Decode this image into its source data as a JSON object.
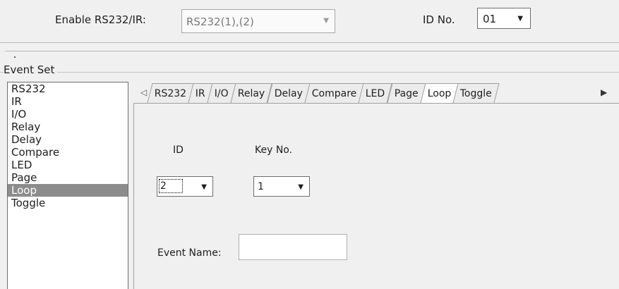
{
  "top": {
    "enable_label": "Enable RS232/IR:",
    "rs_combo_value": "RS232(1),(2)",
    "id_label": "ID No.",
    "id_value": "01"
  },
  "event_set": {
    "title": "Event Set",
    "list": [
      "RS232",
      "IR",
      "I/O",
      "Relay",
      "Delay",
      "Compare",
      "LED",
      "Page",
      "Loop",
      "Toggle"
    ],
    "selected": "Loop"
  },
  "tabs": [
    "RS232",
    "IR",
    "I/O",
    "Relay",
    "Delay",
    "Compare",
    "LED",
    "Page",
    "Loop",
    "Toggle"
  ],
  "active_tab": "Loop",
  "loop_pane": {
    "id_label": "ID",
    "id_value": "2",
    "key_label": "Key No.",
    "key_value": "1",
    "event_name_label": "Event Name:",
    "event_name_value": ""
  },
  "icons": {
    "dropdown": "chevron-down-icon",
    "tab_prev": "scroll-left-icon",
    "tab_next": "scroll-right-icon"
  }
}
